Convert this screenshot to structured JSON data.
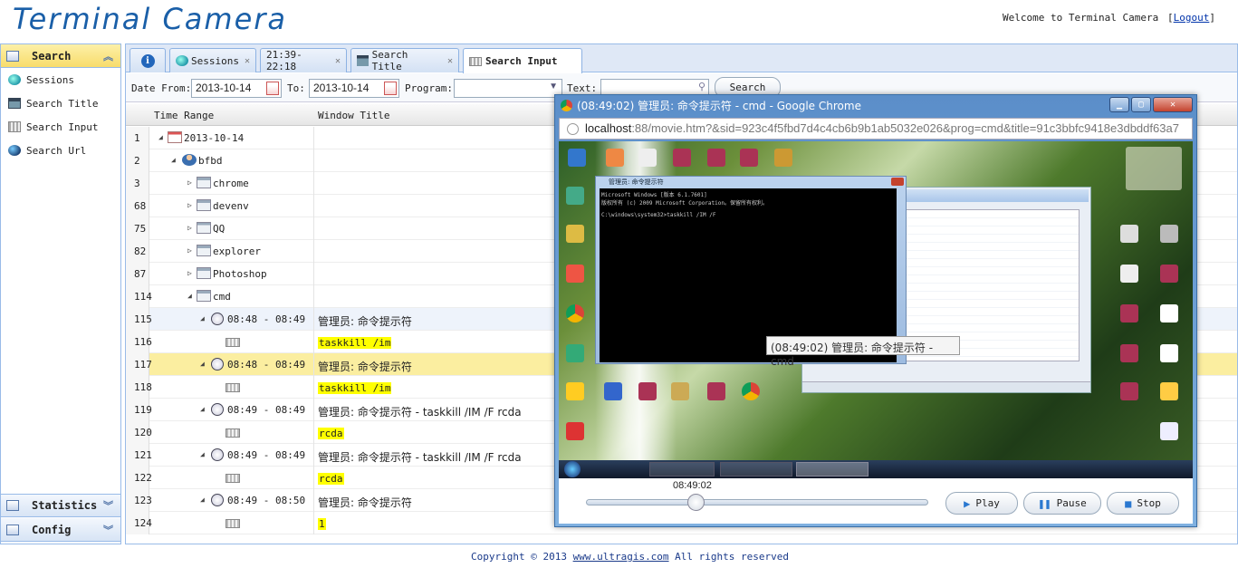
{
  "header": {
    "logo": "Terminal Camera",
    "welcome": "Welcome to Terminal Camera",
    "logout_open": "[",
    "logout_label": "Logout",
    "logout_close": "]"
  },
  "sidebar": {
    "search_label": "Search",
    "items": [
      {
        "label": "Sessions"
      },
      {
        "label": "Search Title"
      },
      {
        "label": "Search Input"
      },
      {
        "label": "Search Url"
      }
    ],
    "statistics_label": "Statistics",
    "config_label": "Config"
  },
  "tabs": [
    {
      "label": ""
    },
    {
      "label": "Sessions"
    },
    {
      "label": "21:39-22:18"
    },
    {
      "label": "Search Title"
    },
    {
      "label": "Search Input"
    }
  ],
  "filter": {
    "date_from_label": "Date From:",
    "date_from": "2013-10-14",
    "to_label": "To:",
    "date_to": "2013-10-14",
    "program_label": "Program:",
    "text_label": "Text:",
    "search_button": "Search"
  },
  "grid": {
    "col_time": "Time Range",
    "col_title": "Window Title",
    "rows": [
      {
        "n": "1",
        "label": "2013-10-14",
        "title": ""
      },
      {
        "n": "2",
        "label": "bfbd",
        "title": ""
      },
      {
        "n": "3",
        "label": "chrome",
        "title": ""
      },
      {
        "n": "68",
        "label": "devenv",
        "title": ""
      },
      {
        "n": "75",
        "label": "QQ",
        "title": ""
      },
      {
        "n": "82",
        "label": "explorer",
        "title": ""
      },
      {
        "n": "87",
        "label": "Photoshop",
        "title": ""
      },
      {
        "n": "114",
        "label": "cmd",
        "title": ""
      },
      {
        "n": "115",
        "label": "08:48 - 08:49",
        "title": "管理员: 命令提示符"
      },
      {
        "n": "116",
        "label": "",
        "title": "taskkill /im"
      },
      {
        "n": "117",
        "label": "08:48 - 08:49",
        "title": "管理员: 命令提示符"
      },
      {
        "n": "118",
        "label": "",
        "title": "taskkill /im"
      },
      {
        "n": "119",
        "label": "08:49 - 08:49",
        "title": "管理员: 命令提示符 - taskkill /IM /F rcda"
      },
      {
        "n": "120",
        "label": "",
        "title": "rcda"
      },
      {
        "n": "121",
        "label": "08:49 - 08:49",
        "title": "管理员: 命令提示符 - taskkill /IM /F rcda"
      },
      {
        "n": "122",
        "label": "",
        "title": "rcda"
      },
      {
        "n": "123",
        "label": "08:49 - 08:50",
        "title": "管理员: 命令提示符"
      },
      {
        "n": "124",
        "label": "",
        "title": "1"
      }
    ]
  },
  "popup": {
    "title": "(08:49:02) 管理员: 命令提示符 - cmd - Google Chrome",
    "url_host": "localhost",
    "url_rest": ":88/movie.htm?&sid=923c4f5fbd7d4c4cb6b9b1ab5032e026&prog=cmd&title=91c3bbfc9418e3dbddf63a7",
    "tooltip": "(08:49:02) 管理员: 命令提示符 - cmd",
    "time": "08:49:02",
    "progress": 0.32,
    "play": "Play",
    "pause": "Pause",
    "stop": "Stop",
    "cmd_title": "管理员: 命令提示符",
    "cmd_line1": "Microsoft Windows [版本 6.1.7601]",
    "cmd_line2": "版权所有 (c) 2009 Microsoft Corporation。保留所有权利。",
    "cmd_line3": "C:\\windows\\system32>taskkill /IM /F"
  },
  "footer": {
    "copy_prefix": "Copyright © 2013 ",
    "copy_link": "www.ultragis.com",
    "copy_suffix": " All rights reserved"
  }
}
